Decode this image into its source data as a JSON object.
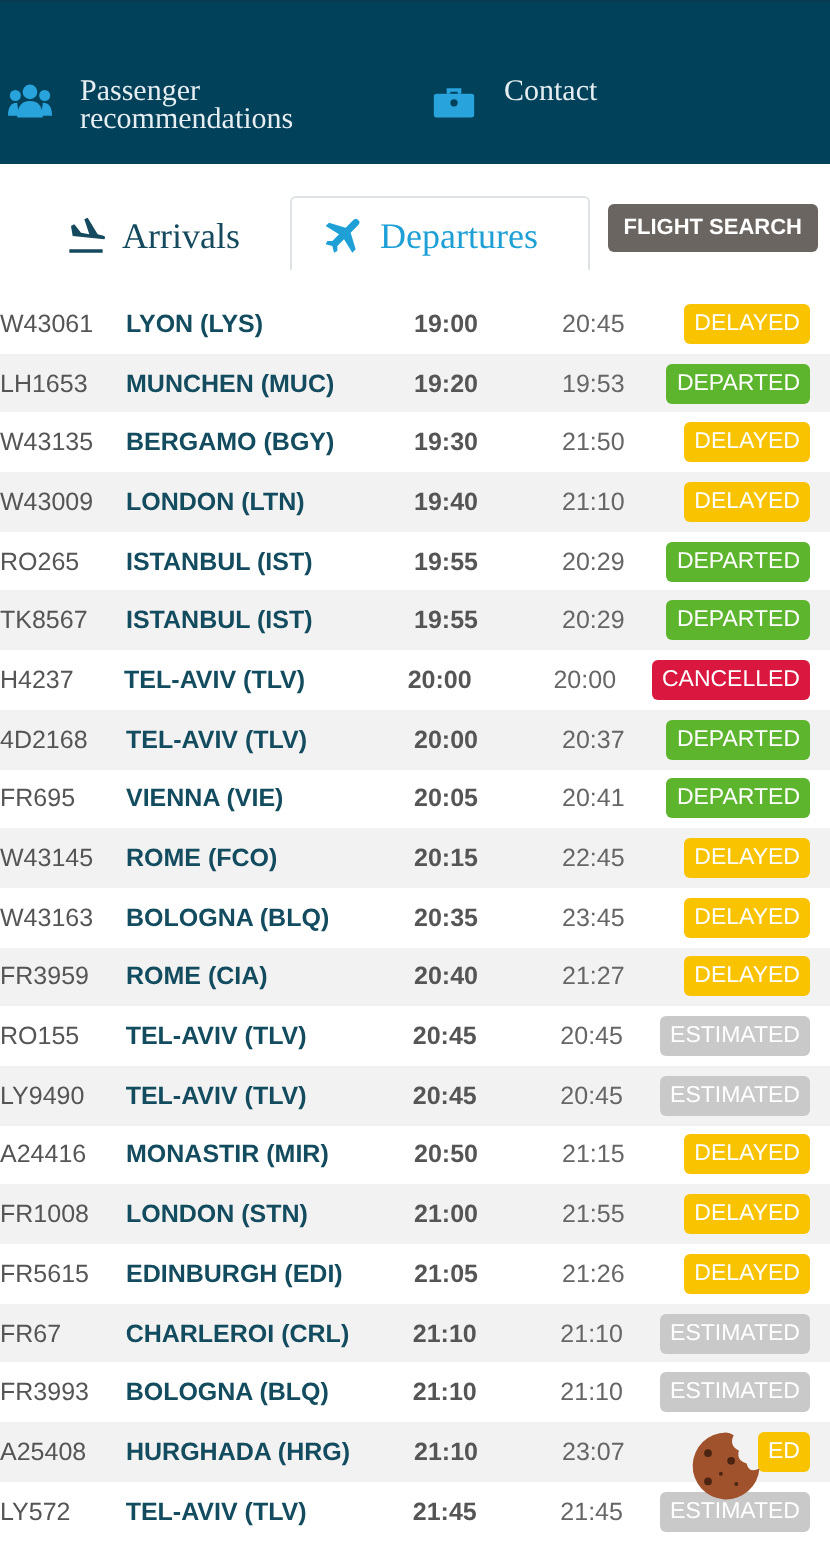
{
  "menu": [
    {
      "kind": "people",
      "label": "Passenger recommendations"
    },
    {
      "kind": "briefcase",
      "label": "Contact"
    }
  ],
  "tabs": [
    {
      "kind": "arrival",
      "label": "Arrivals",
      "selected": false
    },
    {
      "kind": "departure",
      "label": "Departures",
      "selected": true
    }
  ],
  "search_button": "FLIGHT SEARCH",
  "flights": [
    {
      "flight": "W43061",
      "destination": "LYON (LYS)",
      "scheduled": "19:00",
      "estimated": "20:45",
      "status": "DELAYED",
      "kind": "delayed"
    },
    {
      "flight": "LH1653",
      "destination": "MUNCHEN (MUC)",
      "scheduled": "19:20",
      "estimated": "19:53",
      "status": "DEPARTED",
      "kind": "departed"
    },
    {
      "flight": "W43135",
      "destination": "BERGAMO (BGY)",
      "scheduled": "19:30",
      "estimated": "21:50",
      "status": "DELAYED",
      "kind": "delayed"
    },
    {
      "flight": "W43009",
      "destination": "LONDON (LTN)",
      "scheduled": "19:40",
      "estimated": "21:10",
      "status": "DELAYED",
      "kind": "delayed"
    },
    {
      "flight": "RO265",
      "destination": "ISTANBUL (IST)",
      "scheduled": "19:55",
      "estimated": "20:29",
      "status": "DEPARTED",
      "kind": "departed"
    },
    {
      "flight": "TK8567",
      "destination": "ISTANBUL (IST)",
      "scheduled": "19:55",
      "estimated": "20:29",
      "status": "DEPARTED",
      "kind": "departed"
    },
    {
      "flight": "H4237",
      "destination": "TEL-AVIV (TLV)",
      "scheduled": "20:00",
      "estimated": "20:00",
      "status": "CANCELLED",
      "kind": "cancelled"
    },
    {
      "flight": "4D2168",
      "destination": "TEL-AVIV (TLV)",
      "scheduled": "20:00",
      "estimated": "20:37",
      "status": "DEPARTED",
      "kind": "departed"
    },
    {
      "flight": "FR695",
      "destination": "VIENNA (VIE)",
      "scheduled": "20:05",
      "estimated": "20:41",
      "status": "DEPARTED",
      "kind": "departed"
    },
    {
      "flight": "W43145",
      "destination": "ROME (FCO)",
      "scheduled": "20:15",
      "estimated": "22:45",
      "status": "DELAYED",
      "kind": "delayed"
    },
    {
      "flight": "W43163",
      "destination": "BOLOGNA (BLQ)",
      "scheduled": "20:35",
      "estimated": "23:45",
      "status": "DELAYED",
      "kind": "delayed"
    },
    {
      "flight": "FR3959",
      "destination": "ROME (CIA)",
      "scheduled": "20:40",
      "estimated": "21:27",
      "status": "DELAYED",
      "kind": "delayed"
    },
    {
      "flight": "RO155",
      "destination": "TEL-AVIV (TLV)",
      "scheduled": "20:45",
      "estimated": "20:45",
      "status": "ESTIMATED",
      "kind": "estimated"
    },
    {
      "flight": "LY9490",
      "destination": "TEL-AVIV (TLV)",
      "scheduled": "20:45",
      "estimated": "20:45",
      "status": "ESTIMATED",
      "kind": "estimated"
    },
    {
      "flight": "A24416",
      "destination": "MONASTIR (MIR)",
      "scheduled": "20:50",
      "estimated": "21:15",
      "status": "DELAYED",
      "kind": "delayed"
    },
    {
      "flight": "FR1008",
      "destination": "LONDON (STN)",
      "scheduled": "21:00",
      "estimated": "21:55",
      "status": "DELAYED",
      "kind": "delayed"
    },
    {
      "flight": "FR5615",
      "destination": "EDINBURGH (EDI)",
      "scheduled": "21:05",
      "estimated": "21:26",
      "status": "DELAYED",
      "kind": "delayed"
    },
    {
      "flight": "FR67",
      "destination": "CHARLEROI (CRL)",
      "scheduled": "21:10",
      "estimated": "21:10",
      "status": "ESTIMATED",
      "kind": "estimated"
    },
    {
      "flight": "FR3993",
      "destination": "BOLOGNA (BLQ)",
      "scheduled": "21:10",
      "estimated": "21:10",
      "status": "ESTIMATED",
      "kind": "estimated"
    },
    {
      "flight": "A25408",
      "destination": "HURGHADA (HRG)",
      "scheduled": "21:10",
      "estimated": "23:07",
      "status": "ED",
      "kind": "delayed"
    },
    {
      "flight": "LY572",
      "destination": "TEL-AVIV (TLV)",
      "scheduled": "21:45",
      "estimated": "21:45",
      "status": "ESTIMATED",
      "kind": "estimated"
    }
  ]
}
